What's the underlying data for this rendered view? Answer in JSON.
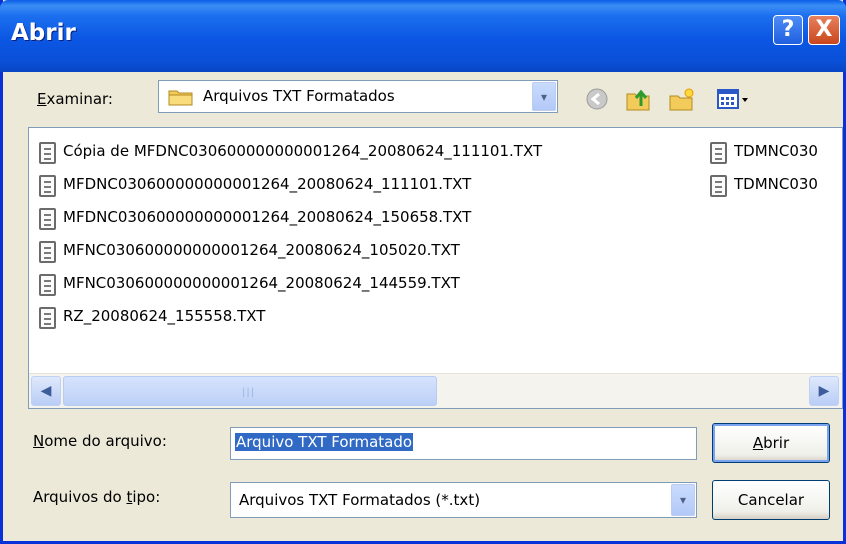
{
  "dialog": {
    "title": "Abrir",
    "help_glyph": "?",
    "close_glyph": "X"
  },
  "lookin": {
    "label_ul": "E",
    "label_rest": "xaminar:",
    "value": "Arquivos TXT Formatados",
    "arrow": "▾"
  },
  "toolbar": {
    "icons": [
      "back-icon",
      "up-folder-icon",
      "new-folder-icon",
      "views-menu-icon"
    ]
  },
  "files": [
    "Cópia de MFDNC030600000000001264_20080624_111101.TXT",
    "MFDNC030600000000001264_20080624_111101.TXT",
    "MFDNC030600000000001264_20080624_150658.TXT",
    "MFNC030600000000001264_20080624_105020.TXT",
    "MFNC030600000000001264_20080624_144559.TXT",
    "RZ_20080624_155558.TXT",
    "TDMNC030",
    "TDMNC030"
  ],
  "filename": {
    "label_ul": "N",
    "label_rest": "ome do arquivo:",
    "value": "Arquivo TXT Formatado"
  },
  "filetype": {
    "label_pre": "Arquivos do ",
    "label_ul": "t",
    "label_post": "ipo:",
    "value": "Arquivos TXT Formatados (*.txt)"
  },
  "buttons": {
    "open_ul": "A",
    "open_rest": "brir",
    "cancel": "Cancelar"
  },
  "scroll": {
    "left": "◀",
    "right": "▶",
    "grip": "|||"
  },
  "colors": {
    "titlebar": "#0a50d8",
    "selection": "#316ac5",
    "close_button": "#c9461d"
  }
}
